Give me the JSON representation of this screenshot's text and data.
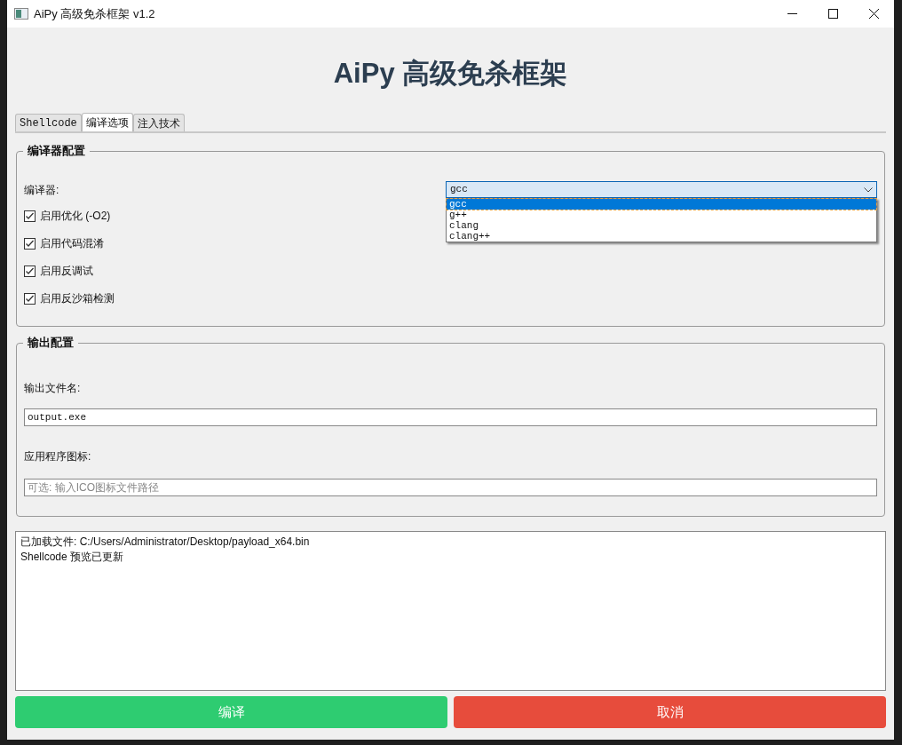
{
  "window": {
    "title": "AiPy 高级免杀框架 v1.2"
  },
  "heading": "AiPy 高级免杀框架",
  "tabs": [
    {
      "label": "Shellcode",
      "selected": false
    },
    {
      "label": "编译选项",
      "selected": true
    },
    {
      "label": "注入技术",
      "selected": false
    }
  ],
  "compiler_group": {
    "title": "编译器配置",
    "compiler_label": "编译器:",
    "compiler_value": "gcc",
    "dropdown": {
      "expanded": true,
      "options": [
        {
          "label": "gcc",
          "selected": true
        },
        {
          "label": "g++",
          "selected": false
        },
        {
          "label": "clang",
          "selected": false
        },
        {
          "label": "clang++",
          "selected": false
        }
      ]
    },
    "options": [
      {
        "label": "启用优化 (-O2)",
        "checked": true
      },
      {
        "label": "启用代码混淆",
        "checked": true
      },
      {
        "label": "启用反调试",
        "checked": true
      },
      {
        "label": "启用反沙箱检测",
        "checked": true
      }
    ]
  },
  "output_group": {
    "title": "输出配置",
    "filename_label": "输出文件名:",
    "filename_value": "output.exe",
    "icon_label": "应用程序图标:",
    "icon_placeholder": "可选: 输入ICO图标文件路径"
  },
  "log": [
    "已加载文件: C:/Users/Administrator/Desktop/payload_x64.bin",
    "Shellcode 预览已更新"
  ],
  "buttons": [
    {
      "label": "编译",
      "kind": "primary"
    },
    {
      "label": "取消",
      "kind": "danger"
    }
  ]
}
